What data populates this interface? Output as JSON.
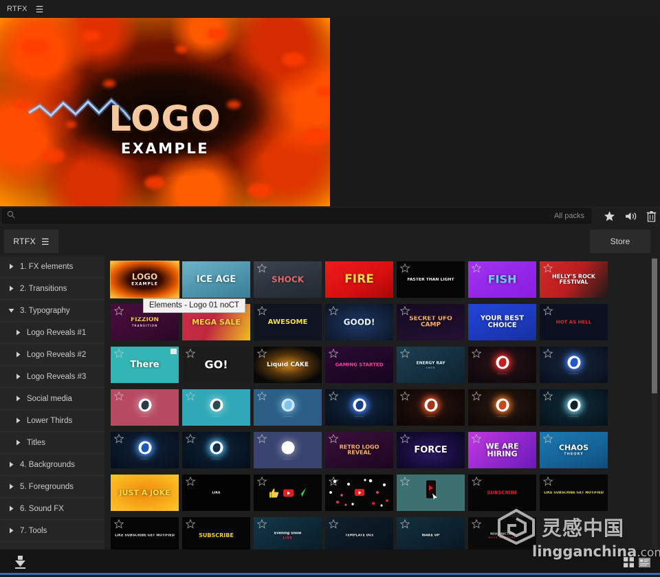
{
  "titlebar": {
    "title": "RTFX",
    "menu_icon": "hamburger-icon"
  },
  "preview": {
    "logo_text": "LOGO",
    "logo_subtext": "EXAMPLE"
  },
  "search": {
    "placeholder": "",
    "value": "",
    "icon": "search-icon",
    "pack_filter": "All packs",
    "tools": [
      {
        "name": "favorite-icon",
        "label": "Favorites"
      },
      {
        "name": "sound-icon",
        "label": "Sound"
      },
      {
        "name": "trash-icon",
        "label": "Delete"
      }
    ]
  },
  "tabs": {
    "active_tab": "RTFX",
    "tab_menu_icon": "hamburger-icon",
    "store_label": "Store"
  },
  "sidebar": {
    "items": [
      {
        "label": "1. FX elements",
        "expanded": false,
        "level": 0
      },
      {
        "label": "2. Transitions",
        "expanded": false,
        "level": 0
      },
      {
        "label": "3. Typography",
        "expanded": true,
        "level": 0
      },
      {
        "label": "Logo Reveals #1",
        "expanded": false,
        "level": 1
      },
      {
        "label": "Logo Reveals #2",
        "expanded": false,
        "level": 1
      },
      {
        "label": "Logo Reveals #3",
        "expanded": false,
        "level": 1
      },
      {
        "label": "Social media",
        "expanded": false,
        "level": 1
      },
      {
        "label": "Lower Thirds",
        "expanded": false,
        "level": 1
      },
      {
        "label": "Titles",
        "expanded": false,
        "level": 1
      },
      {
        "label": "4. Backgrounds",
        "expanded": false,
        "level": 0
      },
      {
        "label": "5. Foregrounds",
        "expanded": false,
        "level": 0
      },
      {
        "label": "6. Sound FX",
        "expanded": false,
        "level": 0
      },
      {
        "label": "7. Tools",
        "expanded": false,
        "level": 0
      }
    ]
  },
  "tooltip": {
    "text": "Elements - Logo 01 noCT"
  },
  "grid": {
    "selected_index": 0,
    "items": [
      {
        "label": "LOGO",
        "sub": "EXAMPLE",
        "kind": "text",
        "bg": "radial-gradient(ellipse at 50% 50%, #1a0600 0%, #3d0d00 35%, #e85a00 68%, #ffd24a 100%)",
        "color": "#f3c8a0",
        "size": 12,
        "subsize": 6,
        "subcolor": "#ffffff",
        "star": false,
        "badge": false
      },
      {
        "label": "ICE AGE",
        "sub": "",
        "kind": "text",
        "bg": "linear-gradient(160deg, #6fb3c6 0%, #4d94ac 55%, #3b7f96 100%)",
        "color": "#eaf6fb",
        "size": 13,
        "subsize": 4,
        "subcolor": "#d8eef6",
        "star": false,
        "badge": false
      },
      {
        "label": "SHOCK",
        "sub": "",
        "kind": "text",
        "bg": "linear-gradient(165deg, #3c4450 0%, #2b323c 60%, #232932 100%)",
        "color": "#e06a6a",
        "size": 12,
        "subsize": 4,
        "subcolor": "#9aa4ae",
        "star": true,
        "badge": false
      },
      {
        "label": "FIRE",
        "sub": "",
        "kind": "text",
        "bg": "linear-gradient(150deg, #f01b1b 0%, #d60f0f 60%, #a80808 100%)",
        "color": "#ffd83a",
        "size": 17,
        "subsize": 4,
        "subcolor": "#ffe27a",
        "star": false,
        "badge": false
      },
      {
        "label": "FASTER THAN LIGHT",
        "sub": "",
        "kind": "text",
        "bg": "#050505",
        "color": "#f2f2f2",
        "size": 6,
        "subsize": 3,
        "subcolor": "#cccccc",
        "star": true,
        "badge": false
      },
      {
        "label": "FISH",
        "sub": "",
        "kind": "text",
        "bg": "linear-gradient(150deg, #a233f0 0%, #9326e8 55%, #8a1fe0 100%)",
        "color": "#6fc9f5",
        "size": 16,
        "subsize": 3,
        "subcolor": "#cfe9fb",
        "star": true,
        "badge": false
      },
      {
        "label": "HELLY'S ROCK FESTIVAL",
        "sub": "",
        "kind": "text",
        "bg": "linear-gradient(125deg, #d42828 0%, #b81e1e 50%, #1a1a1a 100%)",
        "color": "#ffffff",
        "size": 8,
        "subsize": 3,
        "subcolor": "#ffdddd",
        "star": true,
        "badge": false
      },
      {
        "label": "FIZZION",
        "sub": "TRANSITION",
        "kind": "text",
        "bg": "linear-gradient(150deg, #4a0d3e 0%, #3a0a32 60%, #2a0726 100%)",
        "color": "#f3c54a",
        "size": 9,
        "subsize": 4,
        "subcolor": "#e8b6d8",
        "star": true,
        "badge": false
      },
      {
        "label": "MEGA SALE",
        "sub": "",
        "kind": "text",
        "bg": "linear-gradient(115deg, #c8304a 0%, #c0283f 45%, #f0c020 100%)",
        "color": "#ffd23a",
        "size": 11,
        "subsize": 4,
        "subcolor": "#ffffff",
        "star": false,
        "badge": false
      },
      {
        "label": "AWESOME",
        "sub": "",
        "kind": "text",
        "bg": "#101420",
        "color": "#f2e04a",
        "size": 10,
        "subsize": 3,
        "subcolor": "#c9c9c9",
        "star": true,
        "badge": false
      },
      {
        "label": "GOOD!",
        "sub": "",
        "kind": "text",
        "bg": "radial-gradient(ellipse at 50% 55%, #1d3a66 0%, #12213c 60%, #0b1424 100%)",
        "color": "#eaf4ff",
        "size": 12,
        "subsize": 3,
        "subcolor": "#b9d6f5",
        "star": true,
        "badge": false
      },
      {
        "label": "SECRET UFO CAMP",
        "sub": "",
        "kind": "text",
        "bg": "linear-gradient(170deg, #140a22 0%, #1d0e2c 60%, #241134 100%)",
        "color": "#ffb05a",
        "size": 9,
        "subsize": 3,
        "subcolor": "#ff9ad0",
        "star": true,
        "badge": false
      },
      {
        "label": "YOUR BEST CHOICE",
        "sub": "",
        "kind": "text",
        "bg": "linear-gradient(160deg, #2346d8 0%, #1c39bb 60%, #16309f 100%)",
        "color": "#ffffff",
        "size": 10,
        "subsize": 3,
        "subcolor": "#cfe0ff",
        "star": false,
        "badge": false
      },
      {
        "label": "HOT AS HELL",
        "sub": "",
        "kind": "text",
        "bg": "#0c1020",
        "color": "#e02b2b",
        "size": 7,
        "subsize": 3,
        "subcolor": "#aa2222",
        "star": true,
        "badge": false
      },
      {
        "label": "There",
        "sub": "",
        "kind": "text",
        "bg": "#33b5b5",
        "color": "#ffffff",
        "size": 13,
        "subsize": 4,
        "subcolor": "#e6ffff",
        "star": true,
        "badge": true
      },
      {
        "label": "GO!",
        "sub": "",
        "kind": "text",
        "bg": "#1c1c1c",
        "color": "#ffffff",
        "size": 16,
        "subsize": 3,
        "subcolor": "#bbbbbb",
        "star": true,
        "badge": false
      },
      {
        "label": "Liquid CAKE",
        "sub": "",
        "kind": "text",
        "bg": "radial-gradient(ellipse at 50% 50%, #d88a1a 0%, #52330a 40%, #080808 75%)",
        "color": "#ffffff",
        "size": 9,
        "subsize": 3,
        "subcolor": "#f3c060",
        "star": true,
        "badge": false
      },
      {
        "label": "GAMING STARTED",
        "sub": "",
        "kind": "text",
        "bg": "linear-gradient(160deg, #2c0a35 0%, #1e0726 60%, #160520 100%)",
        "color": "#ff3ea5",
        "size": 7,
        "subsize": 3,
        "subcolor": "#c38fe0",
        "star": true,
        "badge": false
      },
      {
        "label": "ENERGY RAY",
        "sub": "LOGO",
        "kind": "text",
        "bg": "linear-gradient(150deg, #1b4050 0%, #143040 55%, #0d2230 100%)",
        "color": "#dff2fb",
        "size": 6,
        "subsize": 3,
        "subcolor": "#9fc7dc",
        "star": true,
        "badge": false
      },
      {
        "label": "",
        "sub": "",
        "kind": "blob",
        "bg": "radial-gradient(ellipse at 50% 45%, #2a1418 0%, #160b10 60%, #0c070a 100%)",
        "blob_color": "#ffffff",
        "blob_inner": "#c41f1f",
        "glow": "#ff2a2a",
        "star": true,
        "badge": false
      },
      {
        "label": "",
        "sub": "",
        "kind": "blob",
        "bg": "radial-gradient(ellipse at 50% 45%, #15243a 0%, #0e1828 60%, #080f1a 100%)",
        "blob_color": "#ffffff",
        "blob_inner": "#2456c8",
        "glow": "#4a86ff",
        "star": true,
        "badge": false
      },
      {
        "label": "",
        "sub": "",
        "kind": "blob",
        "bg": "#b74a62",
        "blob_color": "#ffffff",
        "blob_inner": "#2c3a46",
        "glow": "rgba(255,255,255,.35)",
        "star": true,
        "badge": false
      },
      {
        "label": "",
        "sub": "",
        "kind": "blob",
        "bg": "#2fa8b8",
        "blob_color": "#ffffff",
        "blob_inner": "#2c4a52",
        "glow": "rgba(255,255,255,.35)",
        "star": true,
        "badge": false
      },
      {
        "label": "",
        "sub": "",
        "kind": "blob",
        "bg": "#2b5f85",
        "blob_color": "#cfe8fb",
        "blob_inner": "#7fc4ec",
        "glow": "rgba(160,220,255,.5)",
        "star": true,
        "badge": false
      },
      {
        "label": "",
        "sub": "",
        "kind": "blob",
        "bg": "radial-gradient(ellipse at 50% 45%, #122a48 0%, #0a1728 60%, #060d18 100%)",
        "blob_color": "#ffffff",
        "blob_inner": "#1b3f86",
        "glow": "#4a86ff",
        "star": true,
        "badge": false
      },
      {
        "label": "",
        "sub": "",
        "kind": "blob",
        "bg": "radial-gradient(ellipse at 50% 45%, #2a1410 0%, #160a08 60%, #0b0605 100%)",
        "blob_color": "#ffffff",
        "blob_inner": "#a8341a",
        "glow": "#ff5a2a",
        "star": true,
        "badge": false
      },
      {
        "label": "",
        "sub": "",
        "kind": "blob",
        "bg": "radial-gradient(ellipse at 50% 45%, #2a1a12 0%, #160d09 60%, #0b0706 100%)",
        "blob_color": "#ffffff",
        "blob_inner": "#c04a1a",
        "glow": "#ff7a2a",
        "star": true,
        "badge": false
      },
      {
        "label": "",
        "sub": "",
        "kind": "blob",
        "bg": "radial-gradient(ellipse at 50% 45%, #0f2a38 0%, #0a1c26 60%, #060f16 100%)",
        "blob_color": "#ffffff",
        "blob_inner": "#0d2430",
        "glow": "#7fd8f0",
        "star": true,
        "badge": false
      },
      {
        "label": "",
        "sub": "",
        "kind": "blob",
        "bg": "radial-gradient(ellipse at 50% 45%, #10223c 0%, #0a1628 60%, #060e1a 100%)",
        "blob_color": "#ffffff",
        "blob_inner": "#1f58b8",
        "glow": "#4a9aff",
        "star": true,
        "badge": false
      },
      {
        "label": "",
        "sub": "",
        "kind": "blob",
        "bg": "radial-gradient(ellipse at 50% 45%, #0d2338 0%, #081626 60%, #050d16 100%)",
        "blob_color": "#ffffff",
        "blob_inner": "#123050",
        "glow": "#5ab8f0",
        "star": true,
        "badge": false
      },
      {
        "label": "",
        "sub": "",
        "kind": "blob",
        "bg": "#3a4470",
        "blob_color": "#ffffff",
        "blob_inner": "#ffffff",
        "glow": "rgba(255,255,255,.35)",
        "star": true,
        "badge": false
      },
      {
        "label": "RETRO LOGO REVEAL",
        "sub": "",
        "kind": "text",
        "bg": "linear-gradient(160deg, #3a0f3a 0%, #2a0a2c 55%, #1c061e 100%)",
        "color": "#ffb06a",
        "size": 8,
        "subsize": 3,
        "subcolor": "#e08ad0",
        "star": true,
        "badge": false
      },
      {
        "label": "FORCE",
        "sub": "",
        "kind": "text",
        "bg": "radial-gradient(ellipse at 50% 55%, #2a1a66 0%, #150c38 60%, #0a0620 100%)",
        "color": "#ffffff",
        "size": 13,
        "subsize": 3,
        "subcolor": "#a89aff",
        "star": true,
        "badge": false
      },
      {
        "label": "WE ARE HIRING",
        "sub": "",
        "kind": "text",
        "bg": "linear-gradient(135deg, #c03adf 0%, #9a2ad0 45%, #6a1aba 100%)",
        "color": "#ffffff",
        "size": 11,
        "subsize": 4,
        "subcolor": "#ffd0f5",
        "star": true,
        "badge": false
      },
      {
        "label": "CHAOS",
        "sub": "THEORY",
        "kind": "text",
        "bg": "linear-gradient(160deg, #1b7ab0 0%, #15649a 55%, #0f4e7c 100%)",
        "color": "#ffffff",
        "size": 11,
        "subsize": 5,
        "subcolor": "#d5ecfa",
        "star": true,
        "badge": false
      },
      {
        "label": "JUST A JOKE",
        "sub": "",
        "kind": "text",
        "bg": "radial-gradient(ellipse at 50% 50%, #f08a10 0%, #f5a418 45%, #ffc828 100%)",
        "color": "#ffd84a",
        "size": 11,
        "subsize": 4,
        "subcolor": "#ffffff",
        "star": false,
        "badge": false
      },
      {
        "label": "LIKE",
        "sub": "",
        "kind": "text",
        "bg": "#030303",
        "color": "#ffffff",
        "size": 5,
        "subsize": 3,
        "subcolor": "#7f9fff",
        "star": true,
        "badge": false
      },
      {
        "label": "",
        "sub": "",
        "kind": "social",
        "bg": "#050505",
        "star": true,
        "badge": false
      },
      {
        "label": "",
        "sub": "",
        "kind": "confetti",
        "bg": "#060606",
        "star": true,
        "badge": false
      },
      {
        "label": "",
        "sub": "",
        "kind": "phone",
        "bg": "#3d7070",
        "star": true,
        "badge": false
      },
      {
        "label": "SUBSCRIBE",
        "sub": "",
        "kind": "text",
        "bg": "#060606",
        "color": "#e02020",
        "size": 7,
        "subsize": 3,
        "subcolor": "#ffffff",
        "star": true,
        "badge": false
      },
      {
        "label": "LIKE SUBSCRIBE GET NOTIFIED",
        "sub": "",
        "kind": "text",
        "bg": "#070707",
        "color": "#f0e060",
        "size": 5,
        "subsize": 3,
        "subcolor": "#f5d030",
        "star": true,
        "badge": false
      },
      {
        "label": "LIKE SUBSCRIBE GET NOTIFIED",
        "sub": "",
        "kind": "text",
        "bg": "#050505",
        "color": "#e8e8e8",
        "size": 5,
        "subsize": 3,
        "subcolor": "#cccccc",
        "star": true,
        "badge": false
      },
      {
        "label": "SUBSCRIBE",
        "sub": "",
        "kind": "text",
        "bg": "#050505",
        "color": "#f2d020",
        "size": 8,
        "subsize": 3,
        "subcolor": "#ffffff",
        "star": true,
        "badge": false
      },
      {
        "label": "Evening Show",
        "sub": "LIVE",
        "kind": "text",
        "bg": "linear-gradient(150deg, #123848 0%, #0d2836 55%, #091c26 100%)",
        "color": "#ffffff",
        "size": 5,
        "subsize": 4,
        "subcolor": "#ff3a4a",
        "star": true,
        "badge": false
      },
      {
        "label": "TEMPLATE 003",
        "sub": "",
        "kind": "text",
        "bg": "linear-gradient(150deg, #10202e 0%, #0b1823 55%, #07111a 100%)",
        "color": "#e8e8e8",
        "size": 5,
        "subsize": 3,
        "subcolor": "#aaaaaa",
        "star": true,
        "badge": false
      },
      {
        "label": "WAKE UP",
        "sub": "",
        "kind": "text",
        "bg": "linear-gradient(150deg, #123040 0%, #0d2230 55%, #09161f 100%)",
        "color": "#ffffff",
        "size": 5,
        "subsize": 3,
        "subcolor": "#e04050",
        "star": true,
        "badge": false
      },
      {
        "label": "RESURRECTION",
        "sub": "MASS WEAPONS",
        "kind": "text",
        "bg": "#0a0a0a",
        "color": "#d8d8d8",
        "size": 4,
        "subsize": 3,
        "subcolor": "#e03030",
        "star": true,
        "badge": false
      }
    ]
  },
  "bottom": {
    "download_icon": "download-icon",
    "view_modes": [
      {
        "name": "grid-view-icon",
        "active": false
      },
      {
        "name": "list-view-icon",
        "active": true
      }
    ]
  },
  "watermark": {
    "cn": "灵感中国",
    "url": "lingganchina",
    "url_suffix": ".com"
  },
  "colors": {
    "accent": "#2f6fb5",
    "selection": "#e0a93a",
    "panel": "#1e1e1e",
    "sidebar": "#252525"
  }
}
